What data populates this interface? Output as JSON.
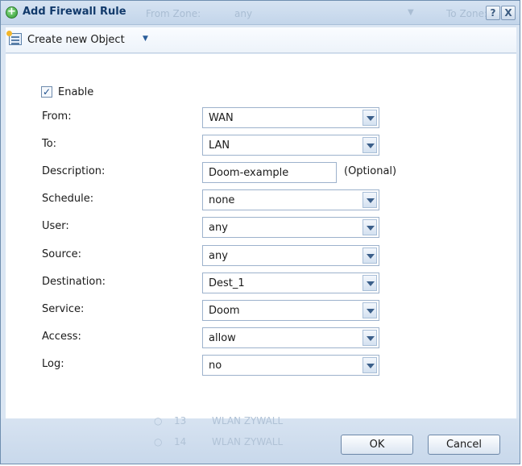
{
  "dialog": {
    "title": "Add Firewall Rule",
    "help_label": "?",
    "close_label": "X",
    "background": {
      "from_zone_label": "From Zone:",
      "from_zone_value": "any",
      "to_zone_label": "To Zone:"
    }
  },
  "toolbar": {
    "create_label": "Create new Object",
    "create_caret": "▼"
  },
  "form": {
    "enable": {
      "label": "Enable",
      "checked": true,
      "check_mark": "✓"
    },
    "fields": [
      {
        "label": "From:",
        "value": "WAN"
      },
      {
        "label": "To:",
        "value": "LAN"
      },
      {
        "label": "Description:",
        "value": "Doom-example",
        "hint": "(Optional)"
      },
      {
        "label": "Schedule:",
        "value": "none"
      },
      {
        "label": "User:",
        "value": "any"
      },
      {
        "label": "Source:",
        "value": "any"
      },
      {
        "label": "Destination:",
        "value": "Dest_1"
      },
      {
        "label": "Service:",
        "value": "Doom"
      },
      {
        "label": "Access:",
        "value": "allow"
      },
      {
        "label": "Log:",
        "value": "no"
      }
    ]
  },
  "background_rows": [
    {
      "num": "13",
      "name": "WLAN  ZYWALL"
    },
    {
      "num": "14",
      "name": "WLAN  ZYWALL"
    }
  ],
  "buttons": {
    "ok": "OK",
    "cancel": "Cancel"
  },
  "colors": {
    "accent": "#123a6b",
    "dialog_bg": "#dbe6f3",
    "border": "#6f8fb0"
  }
}
